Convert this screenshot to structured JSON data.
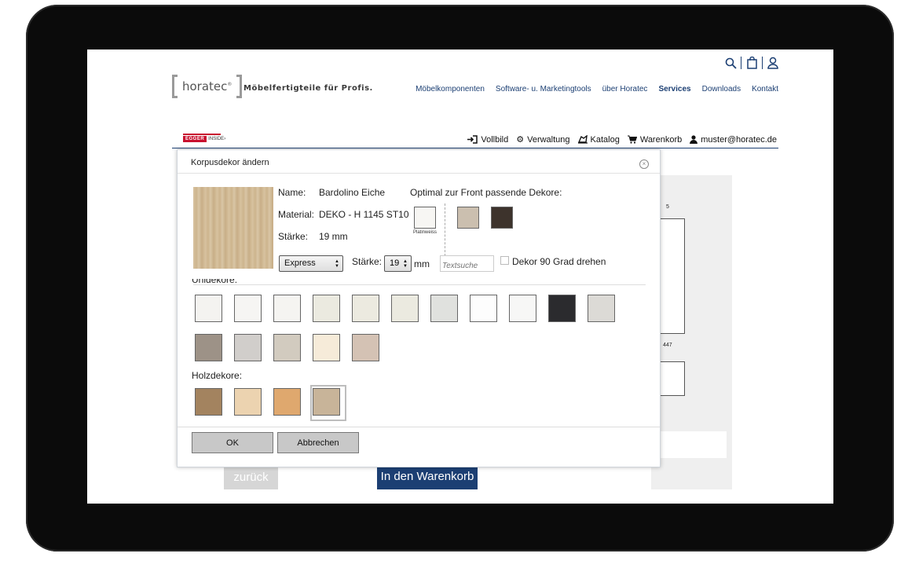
{
  "header": {
    "logo": "horatec",
    "logo_mark": "®",
    "tagline": "Möbelfertigteile für Profis.",
    "icons": [
      "search-icon",
      "bag-icon",
      "user-icon"
    ],
    "nav": [
      "Möbelkomponenten",
      "Software- u. Marketingtools",
      "über Horatec",
      "Services",
      "Downloads",
      "Kontakt"
    ],
    "active_nav": "Services"
  },
  "toolbar": {
    "egger_logo": "EGGER",
    "egger_tag": "INSIDE",
    "fullscreen": "Vollbild",
    "admin": "Verwaltung",
    "catalog": "Katalog",
    "cart": "Warenkorb",
    "user": "muster@horatec.de"
  },
  "background": {
    "dim_top": "5",
    "dim_mid": "447",
    "back_button": "zurück",
    "cart_button": "In den Warenkorb"
  },
  "modal": {
    "title": "Korpusdekor ändern",
    "name_label": "Name:",
    "name_value": "Bardolino Eiche",
    "material_label": "Material:",
    "material_value": "DEKO - H 1145 ST10",
    "thickness_label": "Stärke:",
    "thickness_value": "19 mm",
    "optimal_title": "Optimal zur Front passende Dekore:",
    "optimal_first_label": "Platinweiss",
    "delivery_select": "Express",
    "thickness_field_label": "Stärke:",
    "thickness_select": "19",
    "unit": "mm",
    "search_placeholder": "Textsuche",
    "rotate_label": "Dekor 90 Grad drehen",
    "uni_section": "Unidekore:",
    "wood_section": "Holzdekore:",
    "ok": "OK",
    "cancel": "Abbrechen"
  },
  "colors": {
    "brand_blue": "#1c3f73",
    "egger_red": "#c8102e",
    "optimal_swatches": [
      "#f7f6f3",
      "#cbbfaf",
      "#3d332c"
    ],
    "uni_row1": [
      "#f4f3f0",
      "#f6f5f3",
      "#f5f4f1",
      "#ebeae0",
      "#eceae0",
      "#ebeae0",
      "#e0e1de",
      "#fdfdfd",
      "#f7f7f6",
      "#2b2b2e",
      "#dcdad6"
    ],
    "uni_row2": [
      "#9d9287",
      "#d1cecb",
      "#d2cbbf",
      "#f6ebd9",
      "#d4c2b4"
    ],
    "wood_row": [
      "#a3835f",
      "#ecd3b0",
      "#dfa86e",
      "#c8b499"
    ]
  }
}
